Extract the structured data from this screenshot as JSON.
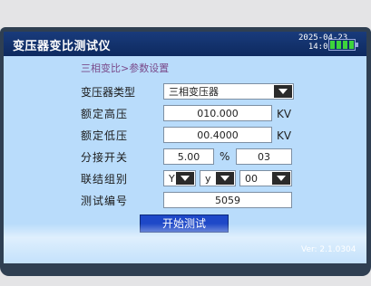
{
  "window": {
    "title": "变压器变比测试仪",
    "date": "2025-04-23",
    "time": "14:09:57"
  },
  "battery": {
    "level_fraction": 1.0
  },
  "breadcrumb": {
    "parent": "三相变比",
    "separator": ">",
    "current": "参数设置"
  },
  "form": {
    "transformer_type": {
      "label": "变压器类型",
      "value": "三相变压器"
    },
    "rated_high": {
      "label": "额定高压",
      "value": "010.000",
      "unit": "KV"
    },
    "rated_low": {
      "label": "额定低压",
      "value": "00.4000",
      "unit": "KV"
    },
    "tap": {
      "label": "分接开关",
      "value": "5.00",
      "unit": "%",
      "position": "03"
    },
    "vector_group": {
      "label": "联结组别",
      "hv": "Y",
      "lv": "y",
      "clock": "00"
    },
    "test_no": {
      "label": "测试编号",
      "value": "5059"
    }
  },
  "actions": {
    "start_label": "开始测试"
  },
  "footer": {
    "version": "Ver: 2.1.0304"
  }
}
